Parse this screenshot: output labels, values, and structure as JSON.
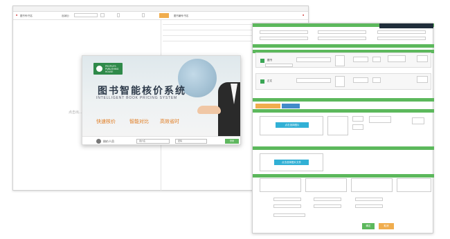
{
  "back_window": {
    "title": "",
    "search_label": "图书号/书名",
    "status_label": "出版社：",
    "left_hint": "点击出...",
    "left_hint_sub": "",
    "right_header": "图书编号/书名"
  },
  "splash": {
    "logo_lines": [
      "PEOPLE'S",
      "PUBLISHING",
      "HOUSE"
    ],
    "title": "图书智能核价系统",
    "subtitle": "INTELLIGENT BOOK PRICING SYSTEM",
    "features": [
      "快速核价",
      "智能对比",
      "高效省时"
    ],
    "user_text": "核价人员",
    "username_placeholder": "用户名",
    "password_placeholder": "密码",
    "login_label": "登录"
  },
  "front_window": {
    "section_labels": [
      "",
      "",
      ""
    ],
    "book_rows": [
      {
        "name": "图书",
        "value": ""
      },
      {
        "name": "正文",
        "value": ""
      }
    ],
    "tabs": [
      "",
      ""
    ],
    "upload_label_1": "点击选择图片",
    "upload_label_2": "点击选择图片文件",
    "confirm_label": "确定",
    "cancel_label": "取消"
  },
  "colors": {
    "green": "#5cb85c",
    "orange": "#f0ad4e",
    "cyan": "#31b0d5"
  }
}
